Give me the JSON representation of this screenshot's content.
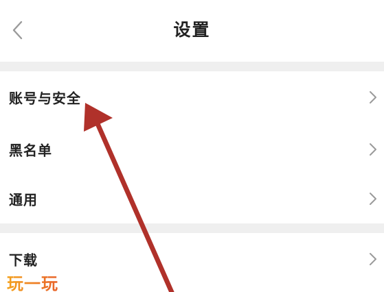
{
  "header": {
    "title": "设置",
    "back_icon": "chevron-left-icon"
  },
  "settings": {
    "items": [
      {
        "label": "账号与安全",
        "icon": "chevron-right-icon"
      },
      {
        "label": "黑名单",
        "icon": "chevron-right-icon"
      },
      {
        "label": "通用",
        "icon": "chevron-right-icon"
      },
      {
        "label": "下载",
        "icon": "chevron-right-icon"
      }
    ]
  },
  "annotation": {
    "type": "arrow",
    "color": "#b0312a",
    "target": "账号与安全"
  },
  "watermark": {
    "text": "玩一玩"
  },
  "colors": {
    "text": "#222222",
    "chevron": "#999999",
    "section_band": "#efefef",
    "background": "#ffffff"
  }
}
